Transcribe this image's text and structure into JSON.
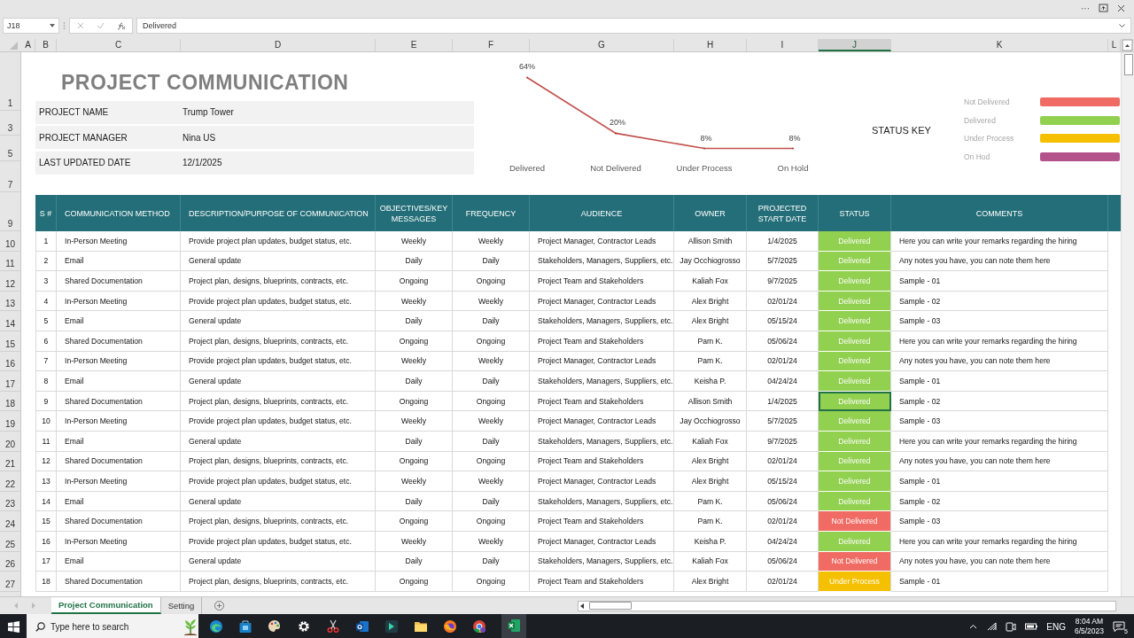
{
  "window": {
    "controls": [
      "···"
    ]
  },
  "formula_bar": {
    "name_box": "J18",
    "formula": "Delivered"
  },
  "column_headers": [
    {
      "label": "A",
      "selected": false
    },
    {
      "label": "B",
      "selected": false
    },
    {
      "label": "C",
      "selected": false
    },
    {
      "label": "D",
      "selected": false
    },
    {
      "label": "E",
      "selected": false
    },
    {
      "label": "F",
      "selected": false
    },
    {
      "label": "G",
      "selected": false
    },
    {
      "label": "H",
      "selected": false
    },
    {
      "label": "I",
      "selected": false
    },
    {
      "label": "J",
      "selected": true
    },
    {
      "label": "K",
      "selected": false
    },
    {
      "label": "L",
      "selected": false
    }
  ],
  "row_numbers": [
    "1",
    "3",
    "5",
    "7",
    "9",
    "10",
    "11",
    "12",
    "13",
    "14",
    "15",
    "16",
    "17",
    "18",
    "19",
    "20",
    "21",
    "22",
    "23",
    "24",
    "25",
    "26",
    "27"
  ],
  "sheet": {
    "title": "PROJECT COMMUNICATION",
    "info": [
      {
        "label": "PROJECT NAME",
        "value": "Trump Tower"
      },
      {
        "label": "PROJECT MANAGER",
        "value": "Nina US"
      },
      {
        "label": "LAST UPDATED DATE",
        "value": "12/1/2025"
      }
    ],
    "chart_data": {
      "type": "line",
      "categories": [
        "Delivered",
        "Not Delivered",
        "Under Process",
        "On Hold"
      ],
      "values": [
        64,
        20,
        8,
        8
      ],
      "data_labels": true,
      "value_labels": [
        "64%",
        "20%",
        "8%",
        "8%"
      ]
    },
    "status_key": {
      "title": "STATUS KEY",
      "items": [
        {
          "label": "Not Delivered",
          "color": "#ef6b63"
        },
        {
          "label": "Delivered",
          "color": "#92d050"
        },
        {
          "label": "Under Process",
          "color": "#f5c000"
        },
        {
          "label": "On Hod",
          "color": "#b4528c"
        }
      ]
    },
    "table": {
      "columns": [
        "S #",
        "COMMUNICATION METHOD",
        "DESCRIPTION/PURPOSE OF COMMUNICATION",
        "OBJECTIVES/KEY MESSAGES",
        "FREQUENCY",
        "AUDIENCE",
        "OWNER",
        "PROJECTED START DATE",
        "STATUS",
        "COMMENTS"
      ],
      "rows": [
        {
          "no": "1",
          "method": "In-Person Meeting",
          "description": "Provide project plan updates, budget status, etc.",
          "objectives": "Weekly",
          "frequency": "Weekly",
          "audience": "Project Manager, Contractor Leads",
          "owner": "Allison Smith",
          "start_date": "1/4/2025",
          "status": {
            "label": "Delivered",
            "color": "#92d050"
          },
          "comments": "Here you can write your remarks regarding the hiring",
          "selected": false
        },
        {
          "no": "2",
          "method": "Email",
          "description": "General update",
          "objectives": "Daily",
          "frequency": "Daily",
          "audience": "Stakeholders, Managers, Suppliers, etc.",
          "owner": "Jay Occhiogrosso",
          "start_date": "5/7/2025",
          "status": {
            "label": "Delivered",
            "color": "#92d050"
          },
          "comments": "Any notes you have, you can note them here",
          "selected": false
        },
        {
          "no": "3",
          "method": "Shared Documentation",
          "description": "Project plan, designs, blueprints, contracts, etc.",
          "objectives": "Ongoing",
          "frequency": "Ongoing",
          "audience": "Project Team and Stakeholders",
          "owner": "Kaliah Fox",
          "start_date": "9/7/2025",
          "status": {
            "label": "Delivered",
            "color": "#92d050"
          },
          "comments": "Sample - 01",
          "selected": false
        },
        {
          "no": "4",
          "method": "In-Person Meeting",
          "description": "Provide project plan updates, budget status, etc.",
          "objectives": "Weekly",
          "frequency": "Weekly",
          "audience": "Project Manager, Contractor Leads",
          "owner": "Alex Bright",
          "start_date": "02/01/24",
          "status": {
            "label": "Delivered",
            "color": "#92d050"
          },
          "comments": "Sample - 02",
          "selected": false
        },
        {
          "no": "5",
          "method": "Email",
          "description": "General update",
          "objectives": "Daily",
          "frequency": "Daily",
          "audience": "Stakeholders, Managers, Suppliers, etc.",
          "owner": "Alex Bright",
          "start_date": "05/15/24",
          "status": {
            "label": "Delivered",
            "color": "#92d050"
          },
          "comments": "Sample - 03",
          "selected": false
        },
        {
          "no": "6",
          "method": "Shared Documentation",
          "description": "Project plan, designs, blueprints, contracts, etc.",
          "objectives": "Ongoing",
          "frequency": "Ongoing",
          "audience": "Project Team and Stakeholders",
          "owner": "Pam K.",
          "start_date": "05/06/24",
          "status": {
            "label": "Delivered",
            "color": "#92d050"
          },
          "comments": "Here you can write your remarks regarding the hiring",
          "selected": false
        },
        {
          "no": "7",
          "method": "In-Person Meeting",
          "description": "Provide project plan updates, budget status, etc.",
          "objectives": "Weekly",
          "frequency": "Weekly",
          "audience": "Project Manager, Contractor Leads",
          "owner": "Pam K.",
          "start_date": "02/01/24",
          "status": {
            "label": "Delivered",
            "color": "#92d050"
          },
          "comments": "Any notes you have, you can note them here",
          "selected": false
        },
        {
          "no": "8",
          "method": "Email",
          "description": "General update",
          "objectives": "Daily",
          "frequency": "Daily",
          "audience": "Stakeholders, Managers, Suppliers, etc.",
          "owner": "Keisha P.",
          "start_date": "04/24/24",
          "status": {
            "label": "Delivered",
            "color": "#92d050"
          },
          "comments": "Sample - 01",
          "selected": false
        },
        {
          "no": "9",
          "method": "Shared Documentation",
          "description": "Project plan, designs, blueprints, contracts, etc.",
          "objectives": "Ongoing",
          "frequency": "Ongoing",
          "audience": "Project Team and Stakeholders",
          "owner": "Allison Smith",
          "start_date": "1/4/2025",
          "status": {
            "label": "Delivered",
            "color": "#92d050"
          },
          "comments": "Sample - 02",
          "selected": true
        },
        {
          "no": "10",
          "method": "In-Person Meeting",
          "description": "Provide project plan updates, budget status, etc.",
          "objectives": "Weekly",
          "frequency": "Weekly",
          "audience": "Project Manager, Contractor Leads",
          "owner": "Jay Occhiogrosso",
          "start_date": "5/7/2025",
          "status": {
            "label": "Delivered",
            "color": "#92d050"
          },
          "comments": "Sample - 03",
          "selected": false
        },
        {
          "no": "11",
          "method": "Email",
          "description": "General update",
          "objectives": "Daily",
          "frequency": "Daily",
          "audience": "Stakeholders, Managers, Suppliers, etc.",
          "owner": "Kaliah Fox",
          "start_date": "9/7/2025",
          "status": {
            "label": "Delivered",
            "color": "#92d050"
          },
          "comments": "Here you can write your remarks regarding the hiring",
          "selected": false
        },
        {
          "no": "12",
          "method": "Shared Documentation",
          "description": "Project plan, designs, blueprints, contracts, etc.",
          "objectives": "Ongoing",
          "frequency": "Ongoing",
          "audience": "Project Team and Stakeholders",
          "owner": "Alex Bright",
          "start_date": "02/01/24",
          "status": {
            "label": "Delivered",
            "color": "#92d050"
          },
          "comments": "Any notes you have, you can note them here",
          "selected": false
        },
        {
          "no": "13",
          "method": "In-Person Meeting",
          "description": "Provide project plan updates, budget status, etc.",
          "objectives": "Weekly",
          "frequency": "Weekly",
          "audience": "Project Manager, Contractor Leads",
          "owner": "Alex Bright",
          "start_date": "05/15/24",
          "status": {
            "label": "Delivered",
            "color": "#92d050"
          },
          "comments": "Sample - 01",
          "selected": false
        },
        {
          "no": "14",
          "method": "Email",
          "description": "General update",
          "objectives": "Daily",
          "frequency": "Daily",
          "audience": "Stakeholders, Managers, Suppliers, etc.",
          "owner": "Pam K.",
          "start_date": "05/06/24",
          "status": {
            "label": "Delivered",
            "color": "#92d050"
          },
          "comments": "Sample - 02",
          "selected": false
        },
        {
          "no": "15",
          "method": "Shared Documentation",
          "description": "Project plan, designs, blueprints, contracts, etc.",
          "objectives": "Ongoing",
          "frequency": "Ongoing",
          "audience": "Project Team and Stakeholders",
          "owner": "Pam K.",
          "start_date": "02/01/24",
          "status": {
            "label": "Not Delivered",
            "color": "#ef6b63"
          },
          "comments": "Sample - 03",
          "selected": false
        },
        {
          "no": "16",
          "method": "In-Person Meeting",
          "description": "Provide project plan updates, budget status, etc.",
          "objectives": "Weekly",
          "frequency": "Weekly",
          "audience": "Project Manager, Contractor Leads",
          "owner": "Keisha P.",
          "start_date": "04/24/24",
          "status": {
            "label": "Delivered",
            "color": "#92d050"
          },
          "comments": "Here you can write your remarks regarding the hiring",
          "selected": false
        },
        {
          "no": "17",
          "method": "Email",
          "description": "General update",
          "objectives": "Daily",
          "frequency": "Daily",
          "audience": "Stakeholders, Managers, Suppliers, etc.",
          "owner": "Kaliah Fox",
          "start_date": "05/06/24",
          "status": {
            "label": "Not Delivered",
            "color": "#ef6b63"
          },
          "comments": "Any notes you have, you can note them here",
          "selected": false
        },
        {
          "no": "18",
          "method": "Shared Documentation",
          "description": "Project plan, designs, blueprints, contracts, etc.",
          "objectives": "Ongoing",
          "frequency": "Ongoing",
          "audience": "Project Team and Stakeholders",
          "owner": "Alex Bright",
          "start_date": "02/01/24",
          "status": {
            "label": "Under Process",
            "color": "#f5c000"
          },
          "comments": "Sample - 01",
          "selected": false
        }
      ]
    }
  },
  "sheet_tabs": [
    {
      "label": "Project Communication",
      "selected": true
    },
    {
      "label": "Setting",
      "selected": false
    }
  ],
  "taskbar": {
    "search_placeholder": "Type here to search",
    "language": "ENG",
    "time": "8:04 AM",
    "date": "6/5/2023",
    "notifications": "5"
  }
}
